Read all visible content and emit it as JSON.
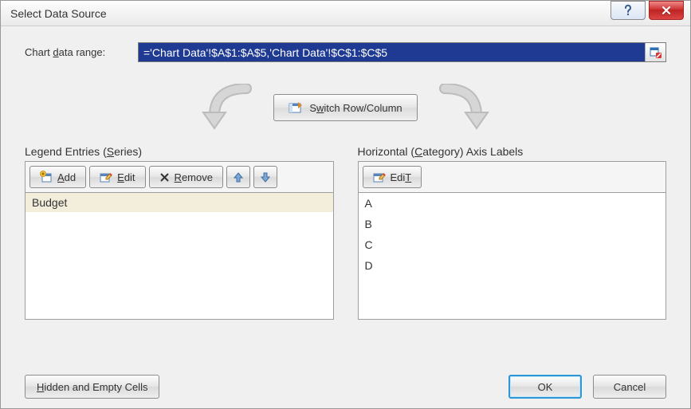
{
  "title": "Select Data Source",
  "rangeLabelPre": "Chart ",
  "rangeLabelU": "d",
  "rangeLabelPost": "ata range:",
  "rangeValue": "='Chart Data'!$A$1:$A$5,'Chart Data'!$C$1:$C$5",
  "switchPre": "S",
  "switchU": "w",
  "switchPost": "itch Row/Column",
  "legendHeaderPre": "Legend Entries (",
  "legendHeaderU": "S",
  "legendHeaderPost": "eries)",
  "catHeaderPre": "Horizontal (",
  "catHeaderU": "C",
  "catHeaderPost": "ategory) Axis Labels",
  "addU": "A",
  "addPost": "dd",
  "editU": "E",
  "editPost": "dit",
  "removeU": "R",
  "removePost": "emove",
  "editCatU": "T",
  "editCatPre": "Edi",
  "series": {
    "0": "Budget"
  },
  "categories": {
    "0": "A",
    "1": "B",
    "2": "C",
    "3": "D"
  },
  "hiddenU": "H",
  "hiddenPost": "idden and Empty Cells",
  "ok": "OK",
  "cancel": "Cancel"
}
